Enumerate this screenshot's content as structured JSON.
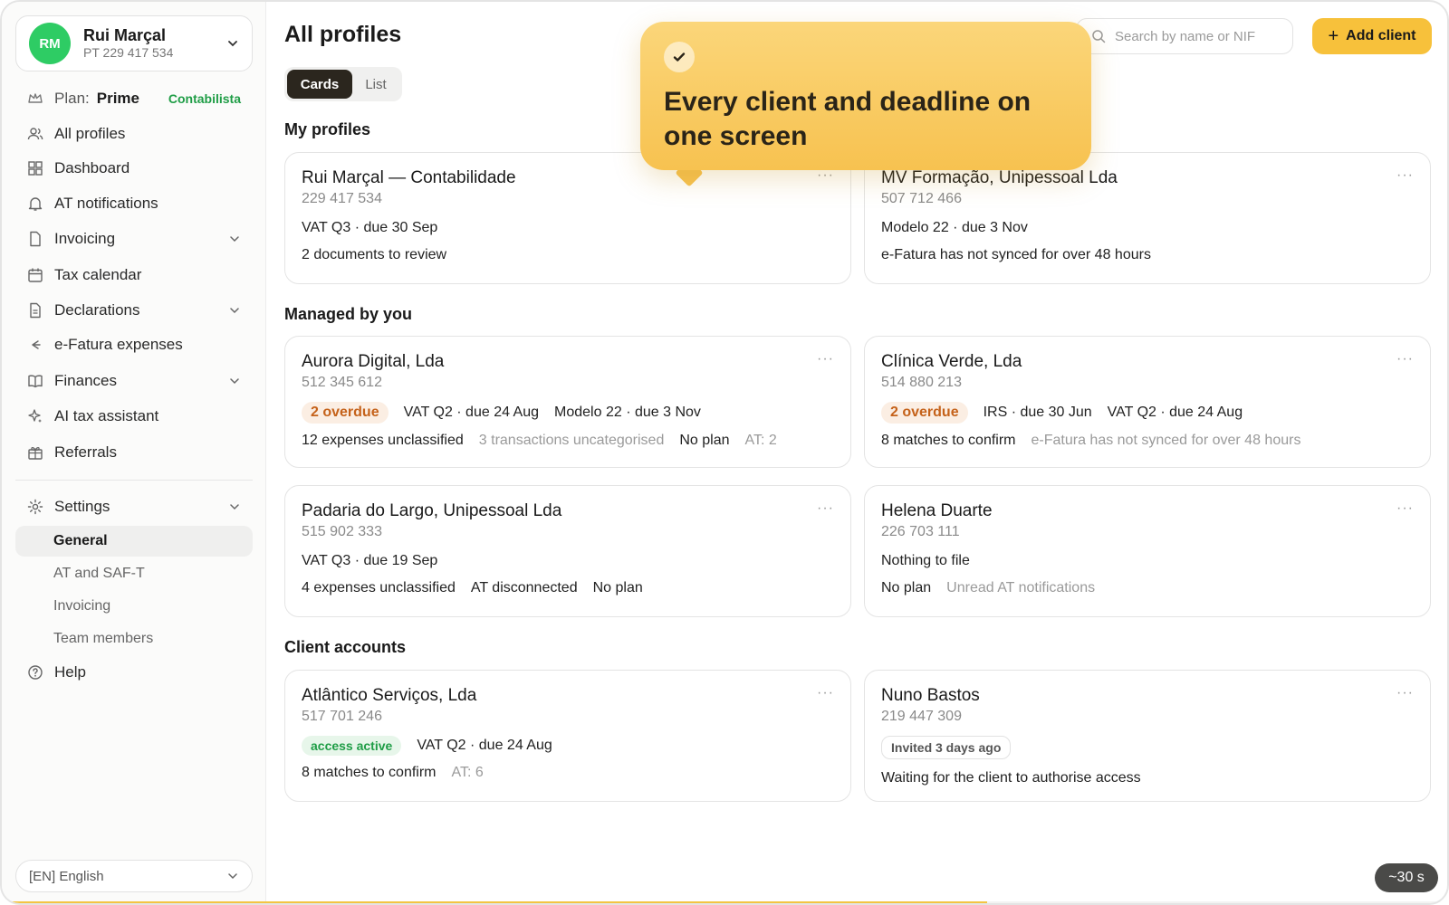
{
  "account": {
    "initials": "RM",
    "name": "Rui Marçal",
    "nif": "PT 229 417 534"
  },
  "plan": {
    "label": "Plan:",
    "value": "Prime",
    "tag": "Contabilista"
  },
  "nav": {
    "all_profiles": "All profiles",
    "dashboard": "Dashboard",
    "at_notifications": "AT notifications",
    "invoicing": "Invoicing",
    "tax_calendar": "Tax calendar",
    "declarations": "Declarations",
    "efatura": "e-Fatura expenses",
    "finances": "Finances",
    "ai_assistant": "AI tax assistant",
    "referrals": "Referrals",
    "settings": "Settings",
    "help": "Help"
  },
  "settings_sub": [
    "General",
    "AT and SAF-T",
    "Invoicing",
    "Team members"
  ],
  "language": "[EN] English",
  "header": {
    "title": "All profiles",
    "search_placeholder": "Search by name or NIF",
    "add_label": "Add client"
  },
  "view_toggle": {
    "cards": "Cards",
    "list": "List",
    "selected": "Cards"
  },
  "sections": {
    "my": "My profiles",
    "managed": "Managed by you",
    "client": "Client accounts"
  },
  "cards": {
    "c1": {
      "name": "Rui Marçal — Contabilidade",
      "nif": "229 417 534",
      "line1": "VAT Q3 · due 30 Sep",
      "line2": "2 documents to review"
    },
    "c2": {
      "name": "MV Formação, Unipessoal Lda",
      "nif": "507 712 466",
      "line1": "Modelo 22 · due 3 Nov",
      "line2": "e-Fatura has not synced for over 48 hours"
    },
    "c3": {
      "name": "Aurora Digital, Lda",
      "nif": "512 345 612",
      "badge": "2 overdue",
      "d1": "VAT Q2 · due 24 Aug",
      "d2": "Modelo 22 · due 3 Nov",
      "m1": "12 expenses unclassified",
      "m2": "3 transactions uncategorised",
      "m3": "No plan",
      "m4": "AT: 2"
    },
    "c4": {
      "name": "Clínica Verde, Lda",
      "nif": "514 880 213",
      "badge": "2 overdue",
      "d1": "IRS · due 30 Jun",
      "d2": "VAT Q2 · due 24 Aug",
      "m1": "8 matches to confirm",
      "m2": "e-Fatura has not synced for over 48 hours"
    },
    "c5": {
      "name": "Padaria do Largo, Unipessoal Lda",
      "nif": "515 902 333",
      "line1": "VAT Q3 · due 19 Sep",
      "m1": "4 expenses unclassified",
      "m2": "AT disconnected",
      "m3": "No plan"
    },
    "c6": {
      "name": "Helena Duarte",
      "nif": "226 703 111",
      "line1": "Nothing to file",
      "m1": "No plan",
      "m2": "Unread AT notifications"
    },
    "c7": {
      "name": "Atlântico Serviços, Lda",
      "nif": "517 701 246",
      "badge": "access active",
      "d1": "VAT Q2 · due 24 Aug",
      "m1": "8 matches to confirm",
      "m2": "AT: 6"
    },
    "c8": {
      "name": "Nuno Bastos",
      "nif": "219 447 309",
      "badge": "Invited 3 days ago",
      "line2": "Waiting for the client to authorise access"
    }
  },
  "more_glyph": "···",
  "callout": {
    "text": "Every client and deadline on one screen"
  },
  "timer": "~30 s",
  "progress": 0.68,
  "colors": {
    "accent": "#f7c13b",
    "green": "#2ecc64",
    "overdue": "#c5621a"
  }
}
